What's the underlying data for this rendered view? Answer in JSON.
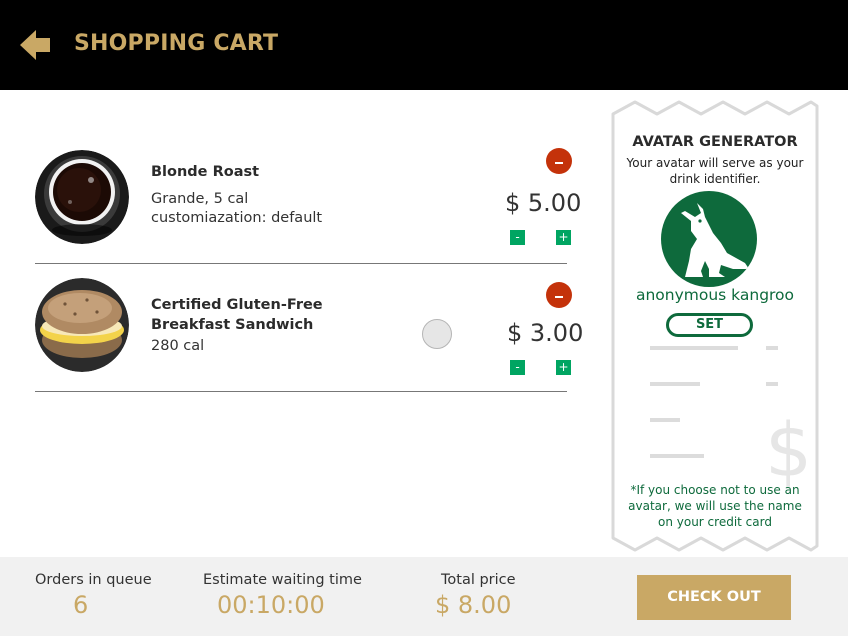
{
  "header": {
    "title": "SHOPPING CART",
    "back_icon": "back-arrow-icon",
    "background": "#000000",
    "accent": "#c9a865"
  },
  "cart": {
    "items": [
      {
        "name": "Blonde Roast",
        "detail_1": "Grande, 5 cal",
        "detail_2": "customiazation: default",
        "price": "$ 5.00",
        "decrement": "-",
        "increment": "+"
      },
      {
        "name_line_1": "Certified Gluten-Free",
        "name_line_2": "Breakfast Sandwich",
        "detail_1": "280 cal",
        "price": "$ 3.00",
        "decrement": "-",
        "increment": "+"
      }
    ],
    "remove_color": "#c4320a",
    "qty_color": "#00a562"
  },
  "avatar": {
    "title": "AVATAR GENERATOR",
    "description": "Your avatar will serve as your drink identifier.",
    "name": "anonymous kangroo",
    "set_label": "SET",
    "note": "*If you choose not to use an avatar, we will use the name on your credit card",
    "color": "#0e6a3c",
    "icon": "kangaroo-icon"
  },
  "footer": {
    "queue_label": "Orders in queue",
    "queue_value": "6",
    "wait_label": "Estimate waiting time",
    "wait_value": "00:10:00",
    "total_label": "Total price",
    "total_value": "$ 8.00",
    "checkout_label": "CHECK OUT"
  }
}
